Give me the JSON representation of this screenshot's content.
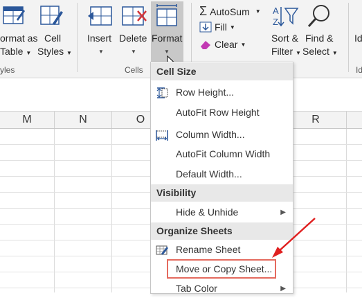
{
  "ribbon": {
    "format_as_table": {
      "line1": "ormat as",
      "line2": "Table"
    },
    "cell_styles": {
      "line1": "Cell",
      "line2": "Styles"
    },
    "styles_group_label": "yles",
    "insert": "Insert",
    "delete": "Delete",
    "format": "Format",
    "cells_group_label": "Cells",
    "autosum": "AutoSum",
    "fill": "Fill",
    "clear": "Clear",
    "sort_filter": {
      "line1": "Sort &",
      "line2": "Filter"
    },
    "find_select": {
      "line1": "Find &",
      "line2": "Select"
    },
    "partial_right": "Id",
    "partial_group_right": "Id"
  },
  "columns": [
    "M",
    "N",
    "O",
    "R"
  ],
  "menu": {
    "sections": [
      {
        "header": "Cell Size",
        "items": [
          {
            "label": "Row Height...",
            "icon": "row-height-icon"
          },
          {
            "label": "AutoFit Row Height",
            "icon": ""
          },
          {
            "label": "Column Width...",
            "icon": "column-width-icon"
          },
          {
            "label": "AutoFit Column Width",
            "icon": ""
          },
          {
            "label": "Default Width...",
            "icon": ""
          }
        ]
      },
      {
        "header": "Visibility",
        "items": [
          {
            "label": "Hide & Unhide",
            "icon": "",
            "submenu": true
          }
        ]
      },
      {
        "header": "Organize Sheets",
        "items": [
          {
            "label": "Rename Sheet",
            "icon": "rename-sheet-icon"
          },
          {
            "label": "Move or Copy Sheet...",
            "icon": ""
          },
          {
            "label": "Tab Color",
            "icon": "",
            "submenu": true
          }
        ]
      }
    ]
  },
  "colors": {
    "annotation": "#e02020",
    "highlight_box": "#e46a5e",
    "ribbon_bg": "#f3f3f3",
    "menu_header_bg": "#e8e8e8"
  }
}
